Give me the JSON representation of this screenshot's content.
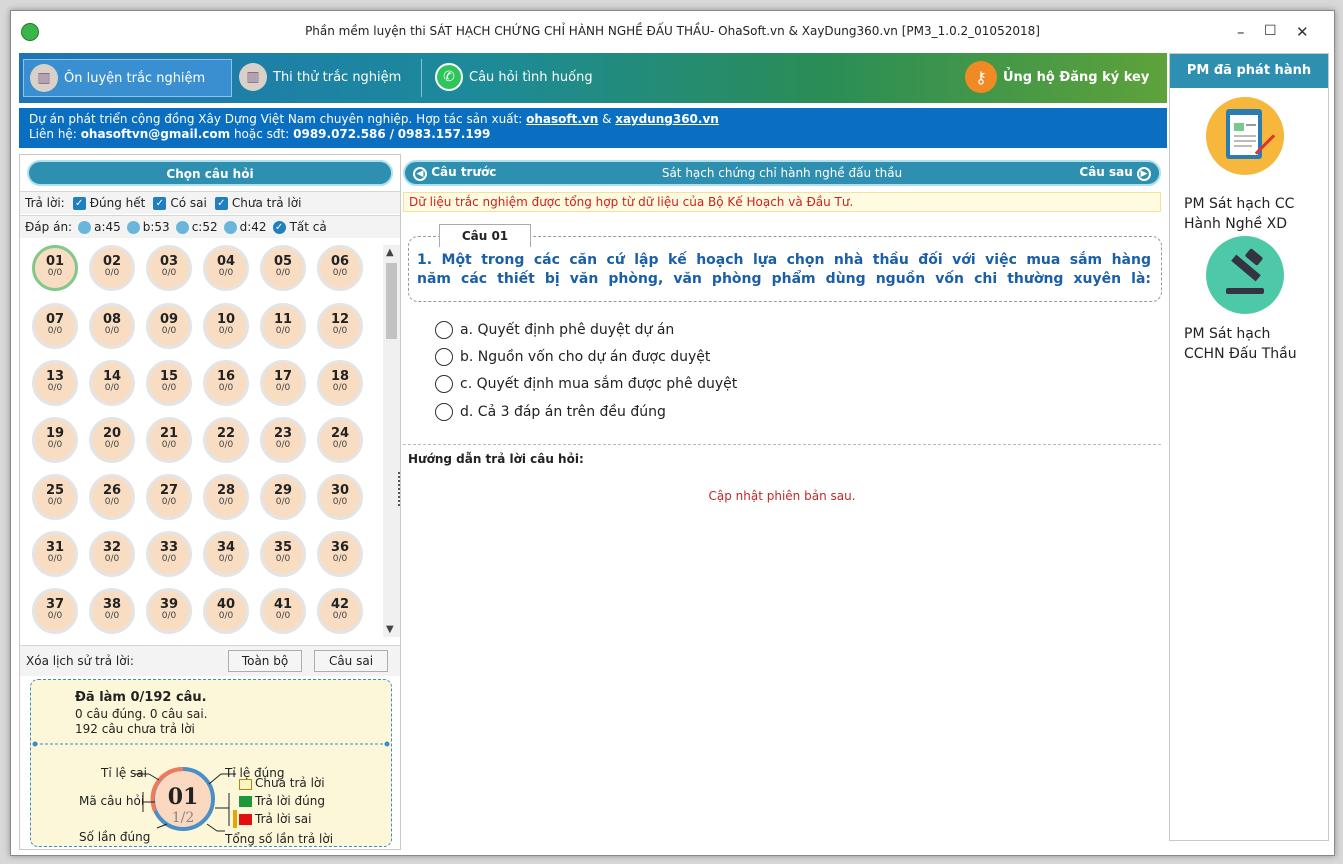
{
  "window": {
    "title": "Phần mềm luyện thi SÁT HẠCH CHỨNG CHỈ HÀNH NGHỀ ĐẤU THẦU- OhaSoft.vn & XayDung360.vn [PM3_1.0.2_01052018]",
    "minimize": "–",
    "maximize": "☐",
    "close": "✕"
  },
  "topnav": {
    "tabs": [
      {
        "label": "Ôn luyện trắc nghiệm"
      },
      {
        "label": "Thi thử trắc nghiệm"
      },
      {
        "label": "Câu hỏi tình huống"
      }
    ],
    "register": "Ủng hộ Đăng ký key"
  },
  "info": {
    "line1_prefix": "Dự án phát triển cộng đồng Xây Dựng Việt Nam chuyên nghiệp. Hợp tác sản xuất:",
    "link1": "ohasoft.vn",
    "amp": "&",
    "link2": "xaydung360.vn",
    "contact_label": "Liên hệ:",
    "email": "ohasoftvn@gmail.com",
    "phone_label": "hoặc sđt:",
    "phone1": "0989.072.586",
    "slash": "/",
    "phone2": "0983.157.199"
  },
  "left": {
    "header": "Chọn câu hỏi",
    "answer_label": "Trả lời:",
    "filters": [
      "Đúng hết",
      "Có sai",
      "Chưa trả lời"
    ],
    "key_label": "Đáp án:",
    "keys": [
      "a:45",
      "b:53",
      "c:52",
      "d:42"
    ],
    "key_all": "Tất cả",
    "clear_label": "Xóa lịch sử trả lời:",
    "clear_all": "Toàn bộ",
    "clear_wrong": "Câu sai"
  },
  "questions": [
    {
      "n": "01",
      "s": "0/0"
    },
    {
      "n": "02",
      "s": "0/0"
    },
    {
      "n": "03",
      "s": "0/0"
    },
    {
      "n": "04",
      "s": "0/0"
    },
    {
      "n": "05",
      "s": "0/0"
    },
    {
      "n": "06",
      "s": "0/0"
    },
    {
      "n": "07",
      "s": "0/0"
    },
    {
      "n": "08",
      "s": "0/0"
    },
    {
      "n": "09",
      "s": "0/0"
    },
    {
      "n": "10",
      "s": "0/0"
    },
    {
      "n": "11",
      "s": "0/0"
    },
    {
      "n": "12",
      "s": "0/0"
    },
    {
      "n": "13",
      "s": "0/0"
    },
    {
      "n": "14",
      "s": "0/0"
    },
    {
      "n": "15",
      "s": "0/0"
    },
    {
      "n": "16",
      "s": "0/0"
    },
    {
      "n": "17",
      "s": "0/0"
    },
    {
      "n": "18",
      "s": "0/0"
    },
    {
      "n": "19",
      "s": "0/0"
    },
    {
      "n": "20",
      "s": "0/0"
    },
    {
      "n": "21",
      "s": "0/0"
    },
    {
      "n": "22",
      "s": "0/0"
    },
    {
      "n": "23",
      "s": "0/0"
    },
    {
      "n": "24",
      "s": "0/0"
    },
    {
      "n": "25",
      "s": "0/0"
    },
    {
      "n": "26",
      "s": "0/0"
    },
    {
      "n": "27",
      "s": "0/0"
    },
    {
      "n": "28",
      "s": "0/0"
    },
    {
      "n": "29",
      "s": "0/0"
    },
    {
      "n": "30",
      "s": "0/0"
    },
    {
      "n": "31",
      "s": "0/0"
    },
    {
      "n": "32",
      "s": "0/0"
    },
    {
      "n": "33",
      "s": "0/0"
    },
    {
      "n": "34",
      "s": "0/0"
    },
    {
      "n": "35",
      "s": "0/0"
    },
    {
      "n": "36",
      "s": "0/0"
    },
    {
      "n": "37",
      "s": "0/0"
    },
    {
      "n": "38",
      "s": "0/0"
    },
    {
      "n": "39",
      "s": "0/0"
    },
    {
      "n": "40",
      "s": "0/0"
    },
    {
      "n": "41",
      "s": "0/0"
    },
    {
      "n": "42",
      "s": "0/0"
    }
  ],
  "stats": {
    "done": "Đã làm 0/192 câu.",
    "correct_wrong": "0 câu đúng. 0 câu sai.",
    "unanswered": "192 câu chưa trả lời",
    "legend": {
      "wrong_rate": "Tỉ lệ sai",
      "right_rate": "Tỉ lệ đúng",
      "code": "Mã câu hỏi",
      "times_right": "Số lần đúng",
      "total": "Tổng số lần trả lời",
      "not_answered": "Chưa trả lời",
      "answered_right": "Trả lời đúng",
      "answered_wrong": "Trả lời sai",
      "sample_num": "01",
      "sample_ratio": "1/2"
    },
    "colors": {
      "not_answered": "#fdf3c4",
      "right": "#1a9a3a",
      "wrong": "#e01010"
    }
  },
  "center": {
    "prev": "Câu trước",
    "next": "Câu sau",
    "topic": "Sát hạch chứng chỉ hành nghề đấu thầu",
    "notice": "Dữ liệu trắc nghiệm được tổng hợp từ dữ liệu của Bộ Kế Hoạch và Đầu Tư.",
    "q_label": "Câu 01",
    "q_line1": "1. Một trong các căn cứ lập kế hoạch lựa chọn nhà thầu đối với việc mua sắm hàng",
    "q_line2": "năm các thiết bị văn phòng, văn phòng phẩm dùng nguồn vốn chi thường xuyên là:",
    "options": [
      "a. Quyết định phê duyệt dự án",
      "b. Nguồn vốn cho dự án được duyệt",
      "c. Quyết định mua sắm được phê duyệt",
      "d. Cả 3 đáp án trên đều đúng"
    ],
    "guide": "Hướng dẫn trả lời câu hỏi:",
    "update": "Cập nhật phiên bản sau."
  },
  "right": {
    "header": "PM đã phát hành",
    "app1_line1": "PM Sát hạch CC",
    "app1_line2": "Hành Nghề XD",
    "app2_line1": "PM Sát hạch",
    "app2_line2": "CCHN Đấu Thầu"
  }
}
